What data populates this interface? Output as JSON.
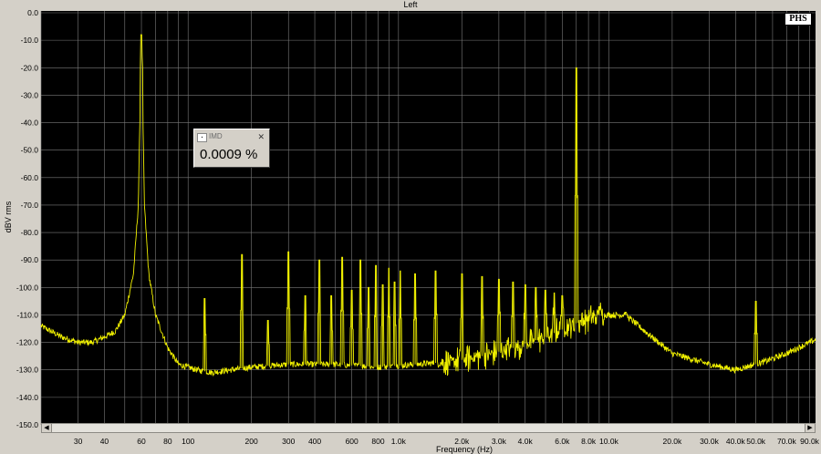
{
  "window": {
    "title": "Left"
  },
  "logo": "PHS",
  "readout": {
    "name": "IMD",
    "value": "0.0009 %",
    "close": "✕"
  },
  "chart_data": {
    "type": "line",
    "title": "Left",
    "xlabel": "Frequency (Hz)",
    "ylabel": "dBV rms",
    "xscale": "log",
    "xlim": [
      20,
      96000
    ],
    "ylim": [
      -150,
      0
    ],
    "grid": true,
    "background": "#000000",
    "line_color": "#f0f000",
    "grid_color": "#7a7a7a",
    "yticks": [
      0,
      -10,
      -20,
      -30,
      -40,
      -50,
      -60,
      -70,
      -80,
      -90,
      -100,
      -110,
      -120,
      -130,
      -140,
      -150
    ],
    "ytick_labels": [
      "0.0",
      "-10.0",
      "-20.0",
      "-30.0",
      "-40.0",
      "-50.0",
      "-60.0",
      "-70.0",
      "-80.0",
      "-90.0",
      "-100.0",
      "-110.0",
      "-120.0",
      "-130.0",
      "-140.0",
      "-150.0"
    ],
    "xticks": [
      30,
      40,
      60,
      80,
      100,
      200,
      300,
      400,
      600,
      800,
      1000,
      2000,
      3000,
      4000,
      6000,
      8000,
      10000,
      20000,
      30000,
      40000,
      50000,
      70000,
      90000
    ],
    "xtick_labels": [
      "30",
      "40",
      "60",
      "80",
      "100",
      "200",
      "300",
      "400",
      "600",
      "800",
      "1.0k",
      "2.0k",
      "3.0k",
      "4.0k",
      "6.0k",
      "8.0k",
      "10.0k",
      "20.0k",
      "30.0k",
      "40.0k",
      "50.0k",
      "70.0k",
      "90.0k"
    ],
    "floor": [
      [
        20,
        -114
      ],
      [
        25,
        -118
      ],
      [
        30,
        -120
      ],
      [
        35,
        -120
      ],
      [
        40,
        -118
      ],
      [
        45,
        -116
      ],
      [
        50,
        -110
      ],
      [
        55,
        -95
      ],
      [
        58,
        -70
      ],
      [
        60,
        -8
      ],
      [
        62,
        -70
      ],
      [
        65,
        -95
      ],
      [
        70,
        -110
      ],
      [
        80,
        -122
      ],
      [
        90,
        -128
      ],
      [
        110,
        -130
      ],
      [
        130,
        -131
      ],
      [
        160,
        -130
      ],
      [
        200,
        -129
      ],
      [
        300,
        -128
      ],
      [
        500,
        -128
      ],
      [
        800,
        -129
      ],
      [
        1200,
        -128
      ],
      [
        1800,
        -127
      ],
      [
        2500,
        -125
      ],
      [
        3500,
        -122
      ],
      [
        5000,
        -118
      ],
      [
        7000,
        -113
      ],
      [
        9000,
        -110
      ],
      [
        12000,
        -110
      ],
      [
        16000,
        -118
      ],
      [
        20000,
        -124
      ],
      [
        30000,
        -128
      ],
      [
        40000,
        -130
      ],
      [
        55000,
        -127
      ],
      [
        70000,
        -124
      ],
      [
        96000,
        -119
      ]
    ],
    "spikes": [
      [
        60,
        -8
      ],
      [
        120,
        -104
      ],
      [
        180,
        -88
      ],
      [
        240,
        -112
      ],
      [
        300,
        -87
      ],
      [
        360,
        -103
      ],
      [
        420,
        -90
      ],
      [
        480,
        -103
      ],
      [
        540,
        -89
      ],
      [
        600,
        -101
      ],
      [
        660,
        -90
      ],
      [
        720,
        -100
      ],
      [
        780,
        -92
      ],
      [
        840,
        -99
      ],
      [
        900,
        -93
      ],
      [
        960,
        -98
      ],
      [
        1020,
        -94
      ],
      [
        1200,
        -95
      ],
      [
        1500,
        -94
      ],
      [
        2000,
        -95
      ],
      [
        2500,
        -96
      ],
      [
        3000,
        -97
      ],
      [
        3500,
        -98
      ],
      [
        4000,
        -99
      ],
      [
        4500,
        -100
      ],
      [
        5000,
        -101
      ],
      [
        5500,
        -102
      ],
      [
        6000,
        -103
      ],
      [
        7000,
        -20
      ],
      [
        9000,
        -107
      ],
      [
        12000,
        -109
      ],
      [
        50000,
        -105
      ]
    ]
  }
}
